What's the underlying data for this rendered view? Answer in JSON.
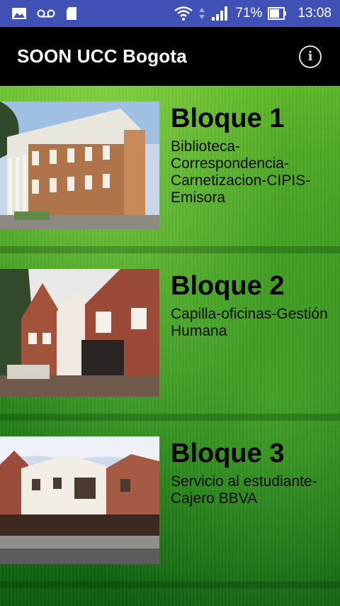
{
  "status_bar": {
    "battery_percent": "71%",
    "time": "13:08"
  },
  "app_bar": {
    "title": "SOON UCC Bogota",
    "info_icon": "info-icon"
  },
  "blocks": [
    {
      "title": "Bloque 1",
      "description": "Biblioteca-Correspondencia-Carnetizacion-CIPIS-Emisora"
    },
    {
      "title": "Bloque 2",
      "description": "Capilla-oficinas-Gestión Humana"
    },
    {
      "title": "Bloque 3",
      "description": "Servicio al estudiante-Cajero BBVA"
    }
  ]
}
